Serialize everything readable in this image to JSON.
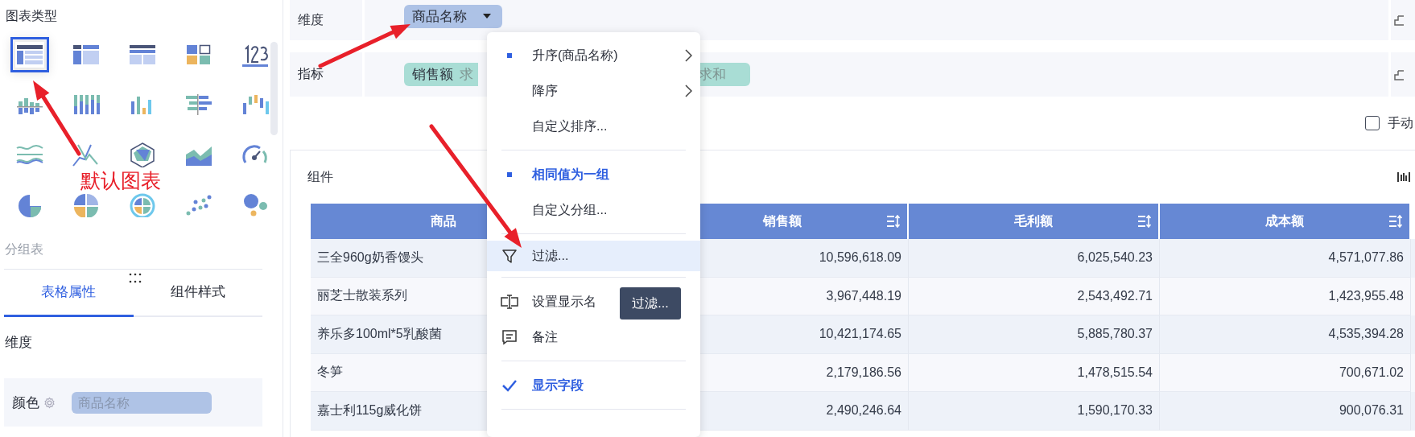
{
  "chart_panel": {
    "title": "图表类型",
    "chart_types": [
      {
        "selected": true
      },
      {
        "selected": false
      },
      {
        "selected": false
      },
      {
        "selected": false
      },
      {
        "selected": false
      },
      {
        "selected": false
      },
      {
        "selected": false
      },
      {
        "selected": false
      },
      {
        "selected": false
      },
      {
        "selected": false
      },
      {
        "selected": false
      },
      {
        "selected": false
      },
      {
        "selected": false
      },
      {
        "selected": false
      },
      {
        "selected": false
      },
      {
        "selected": false
      },
      {
        "selected": false
      },
      {
        "selected": false
      },
      {
        "selected": false
      },
      {
        "selected": false
      }
    ],
    "chart_name": "分组表"
  },
  "property_tabs": [
    {
      "label": "表格属性",
      "selected": true
    },
    {
      "label": "组件样式",
      "selected": false
    }
  ],
  "section_title": "维度",
  "color_row": {
    "label": "颜色",
    "placeholder": "商品名称"
  },
  "dimension_row": {
    "label": "维度",
    "fields": [
      {
        "name": "商品名称"
      }
    ]
  },
  "measure_row": {
    "label": "指标",
    "fields": [
      {
        "name": "销售额",
        "aggregation": "求"
      },
      {
        "aggregation": "求和"
      }
    ]
  },
  "manual_checkbox": {
    "label": "手动",
    "checked": false
  },
  "component": {
    "title": "组件",
    "table": {
      "columns": [
        "商品",
        "销售额",
        "毛利额",
        "成本额"
      ],
      "rows": [
        [
          "三全960g奶香馒头",
          "10,596,618.09",
          "6,025,540.23",
          "4,571,077.86"
        ],
        [
          "丽芝士散装系列",
          "3,967,448.19",
          "2,543,492.71",
          "1,423,955.48"
        ],
        [
          "养乐多100ml*5乳酸菌",
          "10,421,174.65",
          "5,885,780.37",
          "4,535,394.28"
        ],
        [
          "冬笋",
          "2,179,186.56",
          "1,478,515.54",
          "700,671.02"
        ],
        [
          "嘉士利115g威化饼",
          "2,490,246.64",
          "1,590,170.33",
          "900,076.31"
        ]
      ]
    }
  },
  "context_menu": {
    "items": [
      {
        "kind": "sort",
        "label": "升序(商品名称)",
        "selected": true,
        "submenu": true
      },
      {
        "kind": "sort",
        "label": "降序",
        "selected": false,
        "submenu": true
      },
      {
        "kind": "sort",
        "label": "自定义排序...",
        "selected": false,
        "submenu": false
      },
      {
        "kind": "divider"
      },
      {
        "kind": "group",
        "label": "相同值为一组",
        "selected": true
      },
      {
        "kind": "group",
        "label": "自定义分组...",
        "selected": false
      },
      {
        "kind": "divider"
      },
      {
        "kind": "filter",
        "label": "过滤...",
        "highlighted": true
      },
      {
        "kind": "divider"
      },
      {
        "kind": "rename",
        "label": "设置显示名"
      },
      {
        "kind": "note",
        "label": "备注"
      },
      {
        "kind": "divider"
      },
      {
        "kind": "check",
        "label": "显示字段",
        "checked": true
      },
      {
        "kind": "divider"
      }
    ]
  },
  "tooltip": "过滤...",
  "annotation": {
    "label": "默认图表"
  }
}
